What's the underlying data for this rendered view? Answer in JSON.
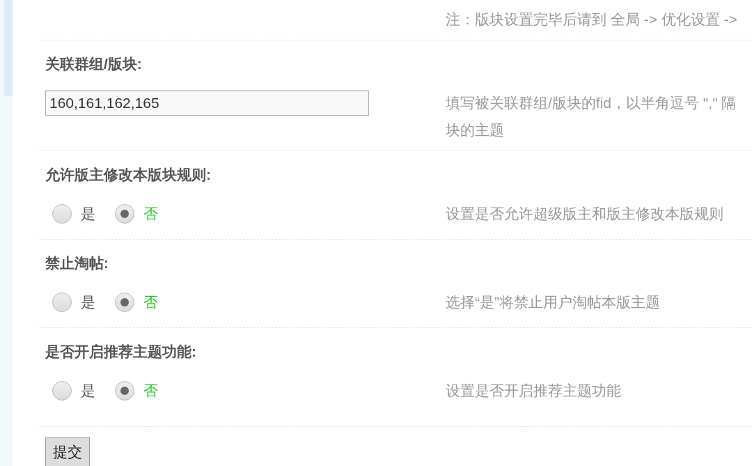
{
  "note": "注：版块设置完毕后请到 全局 -> 优化设置 ->",
  "settings": [
    {
      "kind": "text",
      "label": "关联群组/版块:",
      "value": "160,161,162,165",
      "description": [
        "填写被关联群组/版块的fid，以半角逗号 \",\" 隔",
        "块的主题"
      ]
    },
    {
      "kind": "radio",
      "label": "允许版主修改本版块规则:",
      "options": [
        {
          "label": "是",
          "selected": false
        },
        {
          "label": "否",
          "selected": true
        }
      ],
      "description": [
        "设置是否允许超级版主和版主修改本版规则"
      ]
    },
    {
      "kind": "radio",
      "label": "禁止淘帖:",
      "options": [
        {
          "label": "是",
          "selected": false
        },
        {
          "label": "否",
          "selected": true
        }
      ],
      "description": [
        "选择“是”将禁止用户淘帖本版主题"
      ]
    },
    {
      "kind": "radio",
      "label": "是否开启推荐主题功能:",
      "options": [
        {
          "label": "是",
          "selected": false
        },
        {
          "label": "否",
          "selected": true
        }
      ],
      "description": [
        "设置是否开启推荐主题功能"
      ]
    }
  ],
  "submit_button": "提交"
}
